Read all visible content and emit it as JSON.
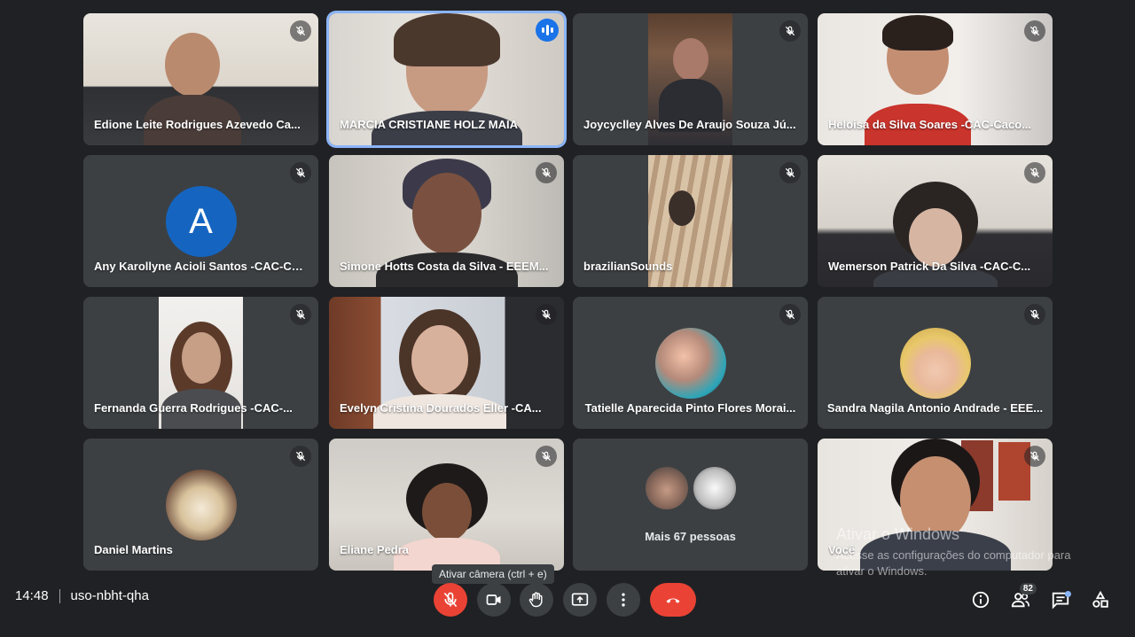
{
  "tiles": [
    {
      "name": "Edione Leite Rodrigues Azevedo Ca...",
      "state": "muted"
    },
    {
      "name": "MARCIA CRISTIANE HOLZ MAIA",
      "state": "speaking"
    },
    {
      "name": "Joycyclley Alves De Araujo Souza Jú...",
      "state": "muted"
    },
    {
      "name": "Heloisa da Silva Soares -CAC-Caco...",
      "state": "muted"
    },
    {
      "name": "Any Karollyne Acioli Santos -CAC-Ca...",
      "state": "muted",
      "avatar_letter": "A"
    },
    {
      "name": "Simone Hotts Costa da Silva - EEEM...",
      "state": "muted"
    },
    {
      "name": "brazilianSounds",
      "state": "muted"
    },
    {
      "name": "Wemerson Patrick Da Silva -CAC-C...",
      "state": "muted"
    },
    {
      "name": "Fernanda Guerra Rodrigues -CAC-...",
      "state": "muted"
    },
    {
      "name": "Evelyn Cristina Dourados Eller -CA...",
      "state": "muted"
    },
    {
      "name": "Tatielle Aparecida Pinto Flores Morai...",
      "state": "muted"
    },
    {
      "name": "Sandra Nagila Antonio Andrade - EEE...",
      "state": "muted"
    },
    {
      "name": "Daniel Martins",
      "state": "muted"
    },
    {
      "name": "Eliane Pedra",
      "state": "muted"
    },
    {
      "more_label": "Mais 67 pessoas"
    },
    {
      "name": "Você",
      "state": "muted"
    }
  ],
  "meeting": {
    "time": "14:48",
    "code": "uso-nbht-qha"
  },
  "controls": {
    "mic_icon": "mic-off-icon",
    "camera_icon": "camera-off-icon",
    "hand_icon": "raise-hand-icon",
    "present_icon": "present-screen-icon",
    "more_icon": "more-vert-icon",
    "hangup_icon": "call-end-icon",
    "tooltip": "Ativar câmera (ctrl + e)"
  },
  "right_panel": {
    "info_icon": "info-icon",
    "people_icon": "people-icon",
    "people_count": "82",
    "chat_icon": "chat-icon",
    "activities_icon": "activities-icon"
  },
  "watermark": {
    "title": "Ativar o Windows",
    "text": "Acesse as configurações do computador para ativar o Windows."
  },
  "colors": {
    "background": "#202124",
    "tile": "#3c4043",
    "accent": "#8ab4f8",
    "danger": "#ea4335"
  }
}
